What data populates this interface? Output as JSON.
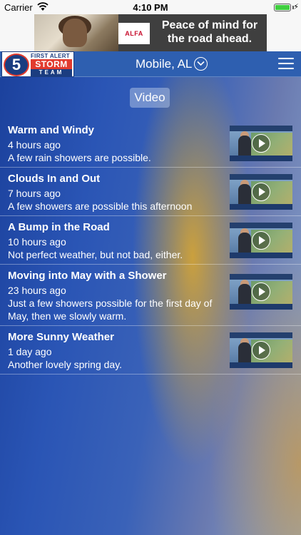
{
  "status_bar": {
    "carrier": "Carrier",
    "time": "4:10 PM"
  },
  "ad": {
    "logo_text": "ALFA",
    "text": "Peace of mind for the road ahead."
  },
  "header": {
    "logo": {
      "number": "5",
      "line1": "FIRST ALERT",
      "line2": "STORM",
      "line3": "TEAM"
    },
    "location": "Mobile, AL"
  },
  "section_label": "Video",
  "videos": [
    {
      "title": "Warm and Windy",
      "age": "4 hours ago",
      "description": "A few rain showers are possible."
    },
    {
      "title": "Clouds In and Out",
      "age": "7 hours ago",
      "description": "A few showers are possible this afternoon"
    },
    {
      "title": "A Bump in the Road",
      "age": "10 hours ago",
      "description": "Not perfect weather, but not bad, either."
    },
    {
      "title": "Moving into May with a Shower",
      "age": "23 hours ago",
      "description": "Just a few showers possible for the first day of May, then we slowly warm."
    },
    {
      "title": "More Sunny Weather",
      "age": "1 day ago",
      "description": "Another lovely spring day."
    }
  ],
  "colors": {
    "header_bg": "#2e5fb0",
    "logo_red": "#e23b2e",
    "logo_blue": "#1b3d80",
    "battery": "#3fcf3f"
  }
}
